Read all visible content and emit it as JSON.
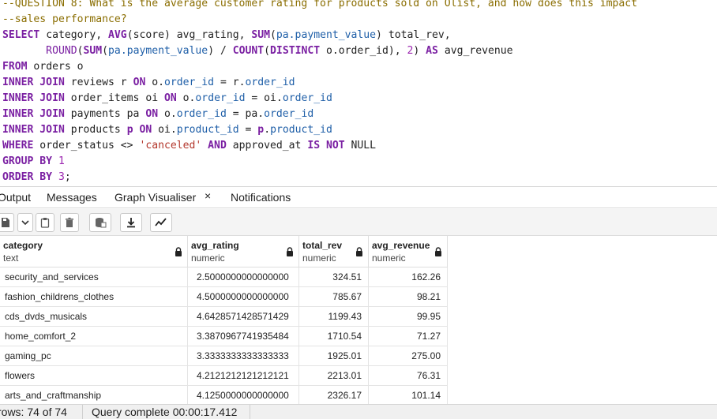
{
  "editor": {
    "lines": [
      [
        {
          "t": "--QUESTION 8: What is the average customer rating for products sold on Olist, and how does this impact",
          "c": "cm"
        }
      ],
      [
        {
          "t": "--sales performance?",
          "c": "cm"
        }
      ],
      [
        {
          "t": "SELECT",
          "c": "kw"
        },
        {
          "t": " category, ",
          "c": "id"
        },
        {
          "t": "AVG",
          "c": "kw"
        },
        {
          "t": "(score) avg_rating, ",
          "c": "id"
        },
        {
          "t": "SUM",
          "c": "kw"
        },
        {
          "t": "(",
          "c": "id"
        },
        {
          "t": "pa.payment_value",
          "c": "fld"
        },
        {
          "t": ") total_rev,",
          "c": "id"
        }
      ],
      [
        {
          "t": "       ROUND",
          "c": "fn"
        },
        {
          "t": "(",
          "c": "id"
        },
        {
          "t": "SUM",
          "c": "kw"
        },
        {
          "t": "(",
          "c": "id"
        },
        {
          "t": "pa.payment_value",
          "c": "fld"
        },
        {
          "t": ") / ",
          "c": "id"
        },
        {
          "t": "COUNT",
          "c": "kw"
        },
        {
          "t": "(",
          "c": "id"
        },
        {
          "t": "DISTINCT",
          "c": "kw"
        },
        {
          "t": " o.order_id), ",
          "c": "id"
        },
        {
          "t": "2",
          "c": "num"
        },
        {
          "t": ") ",
          "c": "id"
        },
        {
          "t": "AS",
          "c": "kw"
        },
        {
          "t": " avg_revenue",
          "c": "id"
        }
      ],
      [
        {
          "t": "FROM",
          "c": "kw"
        },
        {
          "t": " orders o",
          "c": "id"
        }
      ],
      [
        {
          "t": "INNER JOIN",
          "c": "kw"
        },
        {
          "t": " reviews r ",
          "c": "id"
        },
        {
          "t": "ON",
          "c": "kw"
        },
        {
          "t": " o.",
          "c": "id"
        },
        {
          "t": "order_id",
          "c": "fld"
        },
        {
          "t": " = r.",
          "c": "id"
        },
        {
          "t": "order_id",
          "c": "fld"
        }
      ],
      [
        {
          "t": "INNER JOIN",
          "c": "kw"
        },
        {
          "t": " order_items oi ",
          "c": "id"
        },
        {
          "t": "ON",
          "c": "kw"
        },
        {
          "t": " o.",
          "c": "id"
        },
        {
          "t": "order_id",
          "c": "fld"
        },
        {
          "t": " = oi.",
          "c": "id"
        },
        {
          "t": "order_id",
          "c": "fld"
        }
      ],
      [
        {
          "t": "INNER JOIN",
          "c": "kw"
        },
        {
          "t": " payments pa ",
          "c": "id"
        },
        {
          "t": "ON",
          "c": "kw"
        },
        {
          "t": " o.",
          "c": "id"
        },
        {
          "t": "order_id",
          "c": "fld"
        },
        {
          "t": " = pa.",
          "c": "id"
        },
        {
          "t": "order_id",
          "c": "fld"
        }
      ],
      [
        {
          "t": "INNER JOIN",
          "c": "kw"
        },
        {
          "t": " products ",
          "c": "id"
        },
        {
          "t": "p",
          "c": "kw"
        },
        {
          "t": " ",
          "c": "id"
        },
        {
          "t": "ON",
          "c": "kw"
        },
        {
          "t": " oi.",
          "c": "id"
        },
        {
          "t": "product_id",
          "c": "fld"
        },
        {
          "t": " = ",
          "c": "id"
        },
        {
          "t": "p",
          "c": "kw"
        },
        {
          "t": ".",
          "c": "id"
        },
        {
          "t": "product_id",
          "c": "fld"
        }
      ],
      [
        {
          "t": "WHERE",
          "c": "kw"
        },
        {
          "t": " order_status <> ",
          "c": "id"
        },
        {
          "t": "'canceled'",
          "c": "str"
        },
        {
          "t": " ",
          "c": "id"
        },
        {
          "t": "AND",
          "c": "kw"
        },
        {
          "t": " approved_at ",
          "c": "id"
        },
        {
          "t": "IS NOT",
          "c": "kw"
        },
        {
          "t": " NULL",
          "c": "id"
        }
      ],
      [
        {
          "t": "GROUP BY",
          "c": "kw"
        },
        {
          "t": " ",
          "c": "id"
        },
        {
          "t": "1",
          "c": "num"
        }
      ],
      [
        {
          "t": "ORDER BY",
          "c": "kw"
        },
        {
          "t": " ",
          "c": "id"
        },
        {
          "t": "3",
          "c": "num"
        },
        {
          "t": ";",
          "c": "id"
        }
      ]
    ]
  },
  "tabs": {
    "output": "Output",
    "messages": "Messages",
    "graph": "Graph Visualiser",
    "graph_close": "×",
    "notifications": "Notifications"
  },
  "toolbar": {
    "icons": [
      "save-file-icon",
      "chevron-down-icon",
      "copy-icon",
      "delete-icon",
      "save-data-icon",
      "download-icon",
      "graph-icon"
    ]
  },
  "grid": {
    "columns": [
      {
        "name": "category",
        "type": "text"
      },
      {
        "name": "avg_rating",
        "type": "numeric"
      },
      {
        "name": "total_rev",
        "type": "numeric"
      },
      {
        "name": "avg_revenue",
        "type": "numeric"
      }
    ],
    "rows": [
      [
        "security_and_services",
        "2.5000000000000000",
        "324.51",
        "162.26"
      ],
      [
        "fashion_childrens_clothes",
        "4.5000000000000000",
        "785.67",
        "98.21"
      ],
      [
        "cds_dvds_musicals",
        "4.6428571428571429",
        "1199.43",
        "99.95"
      ],
      [
        "home_comfort_2",
        "3.3870967741935484",
        "1710.54",
        "71.27"
      ],
      [
        "gaming_pc",
        "3.3333333333333333",
        "1925.01",
        "275.00"
      ],
      [
        "flowers",
        "4.2121212121212121",
        "2213.01",
        "76.31"
      ],
      [
        "arts_and_craftmanship",
        "4.1250000000000000",
        "2326.17",
        "101.14"
      ]
    ]
  },
  "status": {
    "rows": "rows: 74 of 74",
    "query": "Query complete 00:00:17.412"
  }
}
